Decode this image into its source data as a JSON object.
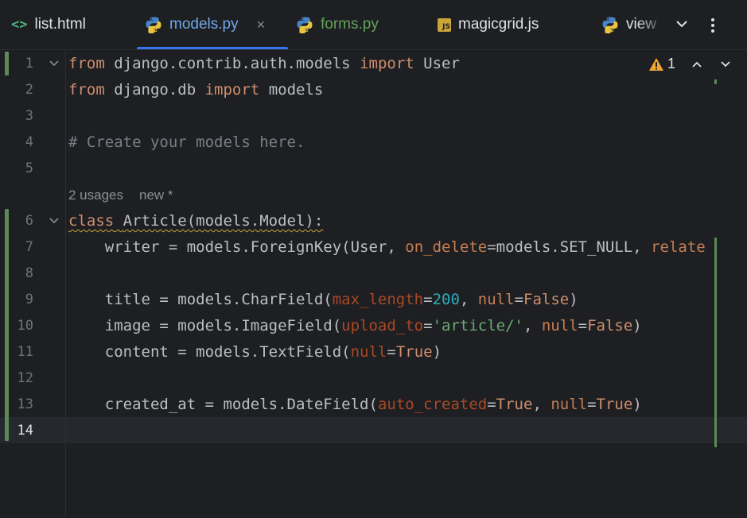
{
  "tabs": [
    {
      "label": "list.html",
      "icon": "html-icon",
      "state": "normal"
    },
    {
      "label": "models.py",
      "icon": "python-icon",
      "state": "active"
    },
    {
      "label": "forms.py",
      "icon": "python-icon",
      "state": "modified"
    },
    {
      "label": "magicgrid.js",
      "icon": "javascript-icon",
      "js_badge": "JS",
      "state": "normal"
    },
    {
      "label": "view",
      "icon": "python-icon",
      "state": "truncated"
    }
  ],
  "tab_close_glyph": "×",
  "tabbar": {
    "more_tabs_glyph": "⌄",
    "menu_glyph": "⋮"
  },
  "inspections": {
    "warning_count": "1",
    "up_glyph": "⌃",
    "down_glyph": "⌄"
  },
  "inlay_hint": {
    "usages": "2 usages",
    "status": "new *"
  },
  "line_numbers": [
    "1",
    "2",
    "3",
    "4",
    "5",
    "6",
    "7",
    "8",
    "9",
    "10",
    "11",
    "12",
    "13",
    "14"
  ],
  "current_line": "14",
  "code": {
    "l1": {
      "t1": "from",
      "t2": " django.contrib.auth.models ",
      "t3": "import",
      "t4": " User"
    },
    "l2": {
      "t1": "from",
      "t2": " django.db ",
      "t3": "import",
      "t4": " models"
    },
    "l4": {
      "t1": "# Create your models here."
    },
    "l6": {
      "t1": "class",
      "t2": " ",
      "t3": "Article(models.Model):"
    },
    "l7": {
      "t1": "    writer = models.ForeignKey(User, ",
      "t2": "on_delete",
      "t3": "=models.SET_NULL, ",
      "t4": "relate"
    },
    "l9": {
      "t1": "    title = models.CharField(",
      "t2": "max_length",
      "t3": "=",
      "t4": "200",
      "t5": ", ",
      "t6": "null",
      "t7": "=",
      "t8": "False",
      "t9": ")"
    },
    "l10": {
      "t1": "    image = models.ImageField(",
      "t2": "upload_to",
      "t3": "=",
      "t4": "'article/'",
      "t5": ", ",
      "t6": "null",
      "t7": "=",
      "t8": "False",
      "t9": ")"
    },
    "l11": {
      "t1": "    content = models.TextField(",
      "t2": "null",
      "t3": "=",
      "t4": "True",
      "t5": ")"
    },
    "l13": {
      "t1": "    created_at = models.DateField(",
      "t2": "auto_created",
      "t3": "=",
      "t4": "True",
      "t5": ", ",
      "t6": "null",
      "t7": "=",
      "t8": "True",
      "t9": ")"
    }
  },
  "colors": {
    "keyword": "#cf8e6d",
    "comment": "#7a7e85",
    "param": "#aa4926",
    "number": "#2aacb8",
    "string": "#6aab73",
    "active_tab": "#6fa7e8",
    "modified_tab": "#62a35b",
    "accent": "#3574f0"
  }
}
